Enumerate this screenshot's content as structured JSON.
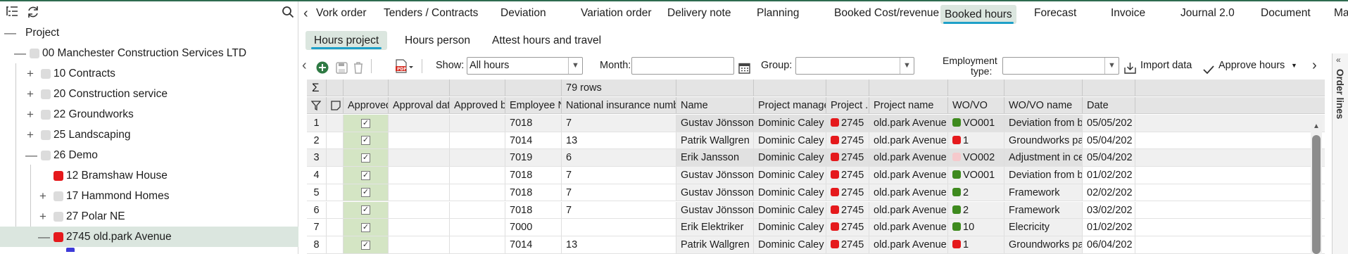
{
  "tree": {
    "items": [
      {
        "label": "Project",
        "toggle": "—",
        "box": ""
      },
      {
        "label": "00 Manchester Construction Services LTD",
        "toggle": "—",
        "box": "grey"
      },
      {
        "label": "10 Contracts",
        "toggle": "+",
        "box": "grey"
      },
      {
        "label": "20 Construction service",
        "toggle": "+",
        "box": "grey"
      },
      {
        "label": "22 Groundworks",
        "toggle": "+",
        "box": "grey"
      },
      {
        "label": "25 Landscaping",
        "toggle": "+",
        "box": "grey"
      },
      {
        "label": "26 Demo",
        "toggle": "—",
        "box": "grey"
      },
      {
        "label": "12 Bramshaw House",
        "toggle": "",
        "box": "red"
      },
      {
        "label": "17 Hammond Homes",
        "toggle": "+",
        "box": "grey"
      },
      {
        "label": "27 Polar NE",
        "toggle": "+",
        "box": "grey"
      },
      {
        "label": "2745 old.park Avenue",
        "toggle": "—",
        "box": "red"
      }
    ]
  },
  "tabs": [
    "Vork order",
    "Tenders / Contracts",
    "Deviation",
    "Variation order",
    "Delivery note",
    "Planning",
    "Booked Cost/revenue",
    "Booked hours",
    "Forecast",
    "Invoice",
    "Journal 2.0",
    "Document",
    "Map"
  ],
  "subtabs": [
    "Hours project",
    "Hours person",
    "Attest hours and travel"
  ],
  "toolbar": {
    "show_label": "Show:",
    "show_value": "All hours",
    "month_label": "Month:",
    "month_value": "",
    "group_label": "Group:",
    "group_value": "",
    "employment_label_1": "Employment",
    "employment_label_2": "type:",
    "employment_value": "",
    "import_label": "Import data",
    "approve_label": "Approve hours"
  },
  "right_strip": {
    "label": "Order lines"
  },
  "grid": {
    "row_count": "79 rows",
    "headers": [
      "",
      "",
      "Approved",
      "Approval date",
      "Approved by",
      "Employee No",
      "National insurance number",
      "Name",
      "Project manager",
      "Project ...",
      "Project name",
      "WO/VO",
      "WO/VO name",
      "Date"
    ],
    "rows": [
      {
        "n": "1",
        "emp": "7018",
        "nin": "7",
        "name": "Gustav Jönsson",
        "pm": "Dominic Caley",
        "proj": "2745",
        "pname": "old.park Avenue",
        "wo": "VO001",
        "wo_color": "#3e8a1e",
        "woname": "Deviation from bl...",
        "date": "05/05/202"
      },
      {
        "n": "2",
        "emp": "7014",
        "nin": "13",
        "name": "Patrik Wallgren",
        "pm": "Dominic Caley",
        "proj": "2745",
        "pname": "old.park Avenue",
        "wo": "1",
        "wo_color": "#e5191c",
        "woname": "Groundworks pac...",
        "date": "05/04/202"
      },
      {
        "n": "3",
        "emp": "7019",
        "nin": "6",
        "name": "Erik Jansson",
        "pm": "Dominic Caley",
        "proj": "2745",
        "pname": "old.park Avenue",
        "wo": "VO002",
        "wo_color": "#f6c9cc",
        "woname": "Adjustment in cei...",
        "date": "05/04/202"
      },
      {
        "n": "4",
        "emp": "7018",
        "nin": "7",
        "name": "Gustav Jönsson",
        "pm": "Dominic Caley",
        "proj": "2745",
        "pname": "old.park Avenue",
        "wo": "VO001",
        "wo_color": "#3e8a1e",
        "woname": "Deviation from bl...",
        "date": "01/02/202"
      },
      {
        "n": "5",
        "emp": "7018",
        "nin": "7",
        "name": "Gustav Jönsson",
        "pm": "Dominic Caley",
        "proj": "2745",
        "pname": "old.park Avenue",
        "wo": "2",
        "wo_color": "#3e8a1e",
        "woname": "Framework",
        "date": "02/02/202"
      },
      {
        "n": "6",
        "emp": "7018",
        "nin": "7",
        "name": "Gustav Jönsson",
        "pm": "Dominic Caley",
        "proj": "2745",
        "pname": "old.park Avenue",
        "wo": "2",
        "wo_color": "#3e8a1e",
        "woname": "Framework",
        "date": "03/02/202"
      },
      {
        "n": "7",
        "emp": "7000",
        "nin": "",
        "name": "Erik Elektriker",
        "pm": "Dominic Caley",
        "proj": "2745",
        "pname": "old.park Avenue",
        "wo": "10",
        "wo_color": "#3e8a1e",
        "woname": "Elecricity",
        "date": "01/02/202"
      },
      {
        "n": "8",
        "emp": "7014",
        "nin": "13",
        "name": "Patrik Wallgren",
        "pm": "Dominic Caley",
        "proj": "2745",
        "pname": "old.park Avenue",
        "wo": "1",
        "wo_color": "#e5191c",
        "woname": "Groundworks pac...",
        "date": "06/04/202"
      }
    ]
  }
}
